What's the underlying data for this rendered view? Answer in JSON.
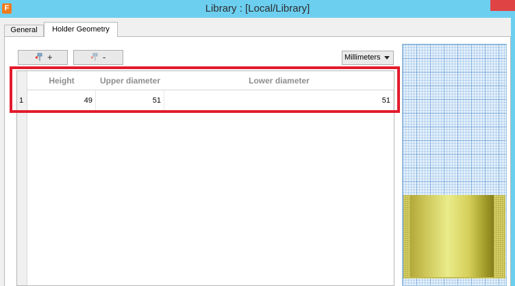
{
  "window": {
    "app_icon": "F",
    "title": "Library :  [Local/Library]"
  },
  "tabs": [
    {
      "label": "General",
      "active": false
    },
    {
      "label": "Holder Geometry",
      "active": true
    }
  ],
  "toolbar": {
    "add_sign": "+",
    "add_icon": "holder-add-icon",
    "remove_sign": "-",
    "remove_icon": "holder-remove-icon"
  },
  "units": {
    "selected": "Millimeters"
  },
  "table": {
    "columns": [
      "Height",
      "Upper diameter",
      "Lower diameter"
    ],
    "rows": [
      {
        "index": "1",
        "height": "49",
        "upper_diameter": "51",
        "lower_diameter": "51"
      }
    ]
  },
  "preview": {
    "grid_color": "#7fb2df",
    "holder_color": "#d6cf5a"
  }
}
